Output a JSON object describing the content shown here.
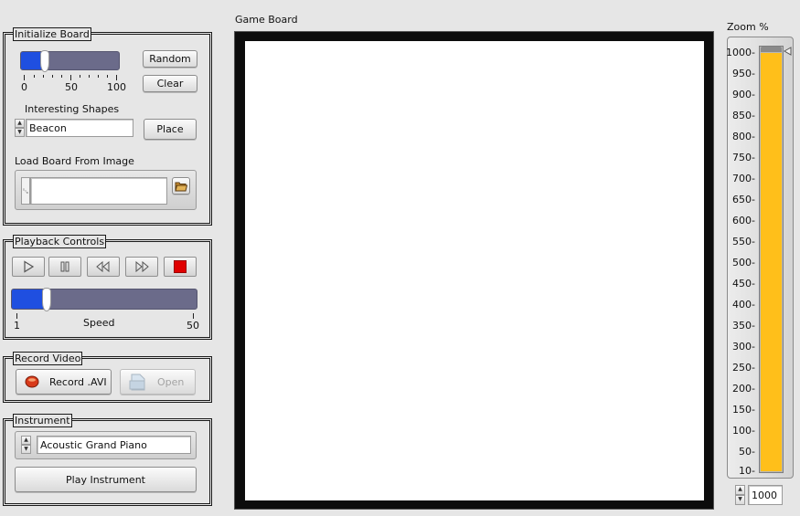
{
  "init_board": {
    "title": "Initialize Board",
    "density": {
      "min": "0",
      "mid": "50",
      "max": "100",
      "value": 20
    },
    "random_label": "Random",
    "clear_label": "Clear",
    "shapes_label": "Interesting Shapes",
    "shape_value": "Beacon",
    "place_label": "Place",
    "load_label": "Load Board From Image",
    "load_path": ""
  },
  "playback": {
    "title": "Playback Controls",
    "speed": {
      "label": "Speed",
      "min": "1",
      "max": "50",
      "value": 5
    },
    "stop_color": "#e00000"
  },
  "record": {
    "title": "Record Video",
    "record_label": "Record .AVI",
    "open_label": "Open"
  },
  "instrument": {
    "title": "Instrument",
    "value": "Acoustic Grand Piano",
    "play_label": "Play Instrument"
  },
  "board": {
    "title": "Game Board"
  },
  "zoom": {
    "title": "Zoom %",
    "scale": [
      "1000-",
      "950-",
      "900-",
      "850-",
      "800-",
      "750-",
      "700-",
      "650-",
      "600-",
      "550-",
      "500-",
      "450-",
      "400-",
      "350-",
      "300-",
      "250-",
      "200-",
      "150-",
      "100-",
      "50-",
      "10-"
    ],
    "value": "1000",
    "fill_color": "#ffbf1a",
    "level": 1.0
  }
}
